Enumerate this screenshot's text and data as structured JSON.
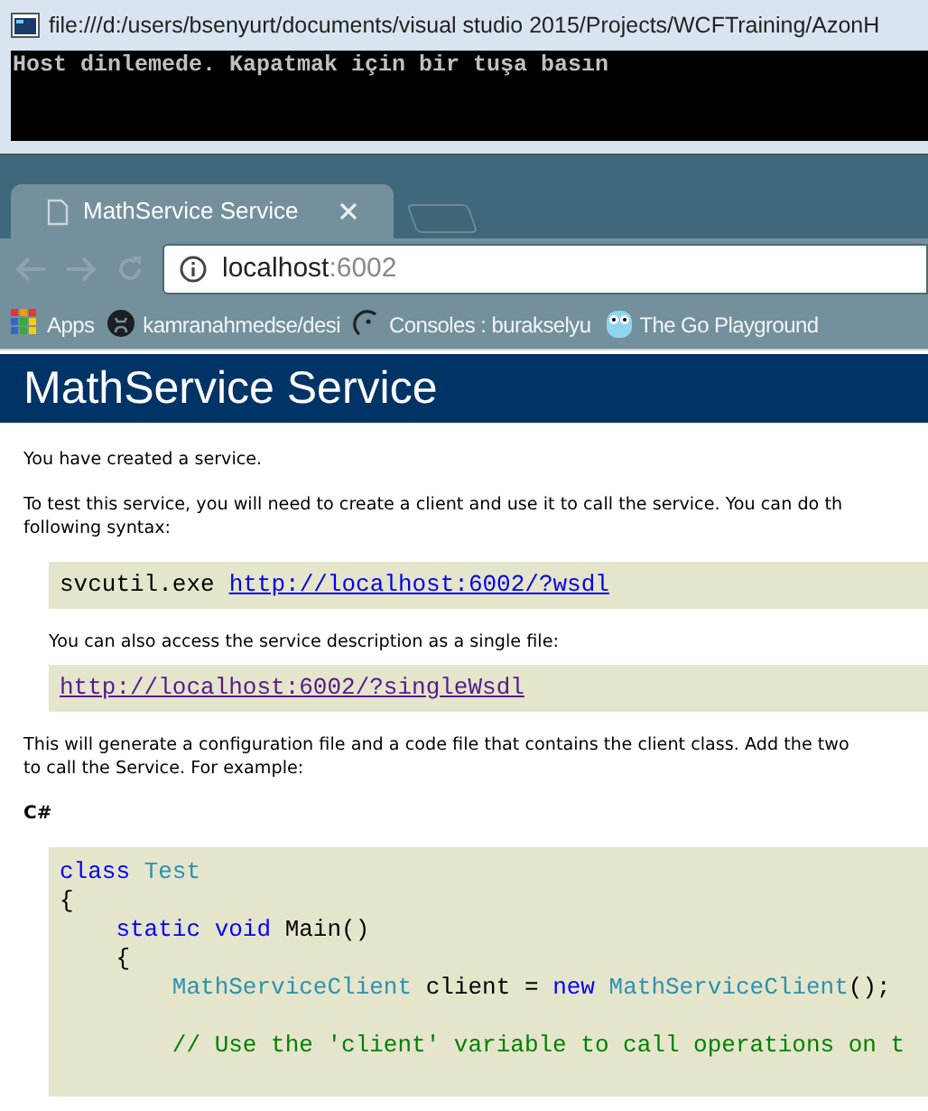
{
  "console": {
    "title": "file:///d:/users/bsenyurt/documents/visual studio 2015/Projects/WCFTraining/AzonH",
    "lines": [
      "Host dinlemede. Kapatmak için bir tuşa basın"
    ]
  },
  "browser": {
    "tabs": [
      {
        "title": "MathService Service",
        "selected": true
      }
    ],
    "address": {
      "host": "localhost",
      "port": ":6002"
    },
    "bookmarks": [
      {
        "kind": "apps",
        "label": "Apps"
      },
      {
        "kind": "github",
        "label": "kamranahmedse/desi"
      },
      {
        "kind": "console",
        "label": "Consoles : burakselyu"
      },
      {
        "kind": "gopher",
        "label": "The Go Playground"
      }
    ]
  },
  "page": {
    "heading": "MathService Service",
    "blocks": [
      {
        "kind": "paragraph",
        "text": "You have created a service."
      },
      {
        "kind": "paragraph",
        "text": "To test this service, you will need to create a client and use it to call the service. You can do th\nfollowing syntax:"
      },
      {
        "kind": "command",
        "parts": [
          {
            "kind": "text",
            "text": "svcutil.exe"
          },
          {
            "kind": "link",
            "text": "http://localhost:6002/?wsdl",
            "visited": false
          }
        ]
      },
      {
        "kind": "note",
        "text": "You can also access the service description as a single file:"
      },
      {
        "kind": "command",
        "parts": [
          {
            "kind": "link",
            "text": "http://localhost:6002/?singleWsdl",
            "visited": true
          }
        ]
      },
      {
        "kind": "paragraph",
        "text": "This will generate a configuration file and a code file that contains the client class. Add the two\nto call the Service. For example:"
      },
      {
        "kind": "label",
        "text": "C#"
      },
      {
        "kind": "code",
        "groups": [
          [
            {
              "tokens": [
                {
                  "kind": "keyword",
                  "text": "class"
                },
                {
                  "kind": "type",
                  "text": " Test"
                }
              ]
            },
            {
              "tokens": [
                {
                  "kind": "plain",
                  "text": "{"
                }
              ]
            },
            {
              "tokens": [
                {
                  "kind": "keyword",
                  "text": "    static"
                },
                {
                  "kind": "keyword",
                  "text": " void"
                },
                {
                  "kind": "plain",
                  "text": " Main()"
                }
              ]
            },
            {
              "tokens": [
                {
                  "kind": "plain",
                  "text": "    {"
                }
              ]
            },
            {
              "tokens": [
                {
                  "kind": "type",
                  "text": "        MathServiceClient"
                },
                {
                  "kind": "plain",
                  "text": " client ="
                },
                {
                  "kind": "keyword",
                  "text": " new"
                },
                {
                  "kind": "type",
                  "text": " MathServiceClient"
                },
                {
                  "kind": "plain",
                  "text": "();"
                }
              ]
            }
          ],
          [
            {
              "tokens": [
                {
                  "kind": "comment",
                  "text": "        // Use the 'client' variable to call operations on t"
                }
              ]
            }
          ]
        ]
      }
    ]
  }
}
